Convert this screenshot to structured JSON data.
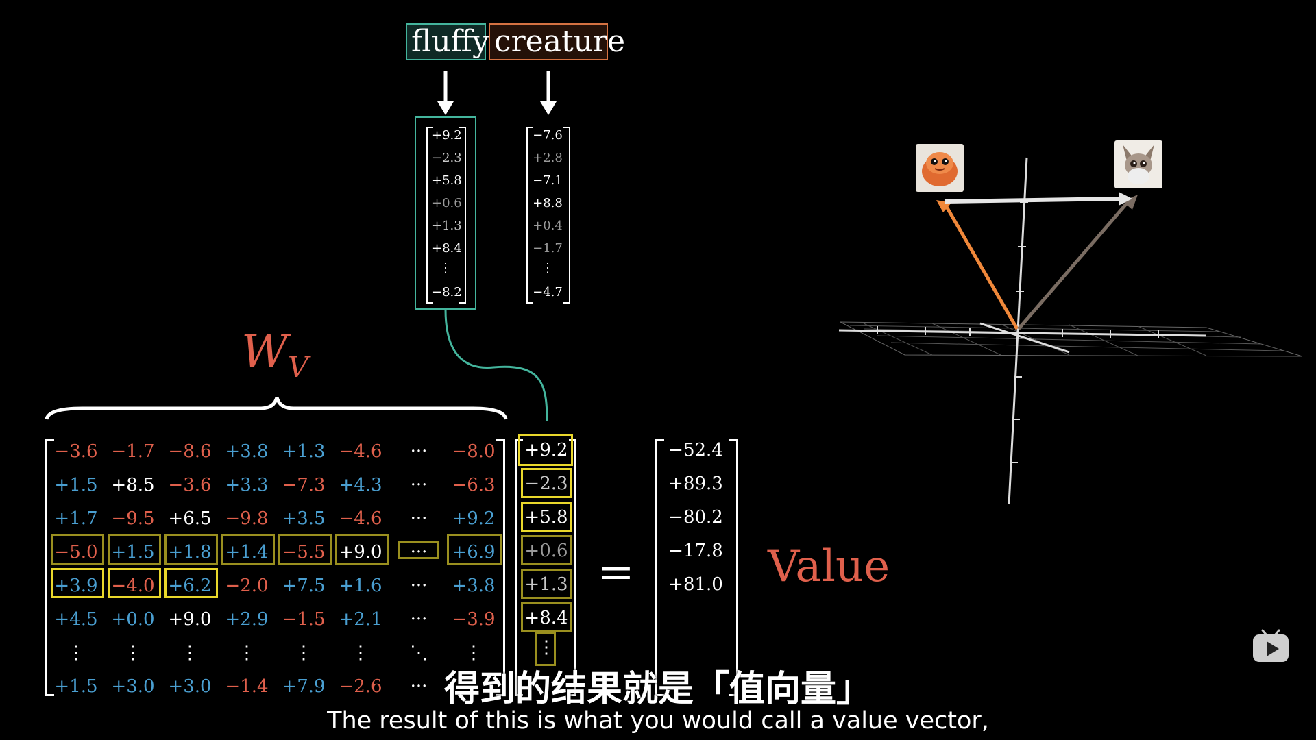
{
  "tokens": [
    {
      "text": "fluffy",
      "color": "#44b59d"
    },
    {
      "text": "creature",
      "color": "#d57242"
    }
  ],
  "embedding_fluffy": [
    "+9.2",
    "−2.3",
    "+5.8",
    "+0.6",
    "+1.3",
    "+8.4",
    "⋮",
    "−8.2"
  ],
  "embedding_creature": [
    "−7.6",
    "+2.8",
    "−7.1",
    "+8.8",
    "+0.4",
    "−1.7",
    "⋮",
    "−4.7"
  ],
  "matrix_label": {
    "main": "W",
    "sub": "V"
  },
  "matrix": [
    [
      [
        "−3.6",
        "red"
      ],
      [
        "−1.7",
        "red"
      ],
      [
        "−8.6",
        "red"
      ],
      [
        "+3.8",
        "blue"
      ],
      [
        "+1.3",
        "blue"
      ],
      [
        "−4.6",
        "red"
      ],
      [
        "···",
        "white"
      ],
      [
        "−8.0",
        "red"
      ]
    ],
    [
      [
        "+1.5",
        "blue"
      ],
      [
        "+8.5",
        "white"
      ],
      [
        "−3.6",
        "red"
      ],
      [
        "+3.3",
        "blue"
      ],
      [
        "−7.3",
        "red"
      ],
      [
        "+4.3",
        "blue"
      ],
      [
        "···",
        "white"
      ],
      [
        "−6.3",
        "red"
      ]
    ],
    [
      [
        "+1.7",
        "blue"
      ],
      [
        "−9.5",
        "red"
      ],
      [
        "+6.5",
        "white"
      ],
      [
        "−9.8",
        "red"
      ],
      [
        "+3.5",
        "blue"
      ],
      [
        "−4.6",
        "red"
      ],
      [
        "···",
        "white"
      ],
      [
        "+9.2",
        "blue"
      ]
    ],
    [
      [
        "−5.0",
        "red"
      ],
      [
        "+1.5",
        "blue"
      ],
      [
        "+1.8",
        "blue"
      ],
      [
        "+1.4",
        "blue"
      ],
      [
        "−5.5",
        "red"
      ],
      [
        "+9.0",
        "white"
      ],
      [
        "···",
        "white"
      ],
      [
        "+6.9",
        "blue"
      ]
    ],
    [
      [
        "+3.9",
        "blue"
      ],
      [
        "−4.0",
        "red"
      ],
      [
        "+6.2",
        "blue"
      ],
      [
        "−2.0",
        "red"
      ],
      [
        "+7.5",
        "blue"
      ],
      [
        "+1.6",
        "blue"
      ],
      [
        "···",
        "white"
      ],
      [
        "+3.8",
        "blue"
      ]
    ],
    [
      [
        "+4.5",
        "blue"
      ],
      [
        "+0.0",
        "blue"
      ],
      [
        "+9.0",
        "white"
      ],
      [
        "+2.9",
        "blue"
      ],
      [
        "−1.5",
        "red"
      ],
      [
        "+2.1",
        "blue"
      ],
      [
        "···",
        "white"
      ],
      [
        "−3.9",
        "red"
      ]
    ],
    [
      [
        "⋮",
        "white"
      ],
      [
        "⋮",
        "white"
      ],
      [
        "⋮",
        "white"
      ],
      [
        "⋮",
        "white"
      ],
      [
        "⋮",
        "white"
      ],
      [
        "⋮",
        "white"
      ],
      [
        "⋱",
        "white"
      ],
      [
        "⋮",
        "white"
      ]
    ],
    [
      [
        "+1.5",
        "blue"
      ],
      [
        "+3.0",
        "blue"
      ],
      [
        "+3.0",
        "blue"
      ],
      [
        "−1.4",
        "red"
      ],
      [
        "+7.9",
        "blue"
      ],
      [
        "−2.6",
        "red"
      ],
      [
        "···",
        "white"
      ],
      [
        "",
        ""
      ]
    ]
  ],
  "input_vector": [
    "+9.2",
    "−2.3",
    "+5.8",
    "+0.6",
    "+1.3",
    "+8.4",
    "⋮"
  ],
  "equals": "=",
  "result_vector": [
    "−52.4",
    "+89.3",
    "−80.2",
    "−17.8",
    "+81.0"
  ],
  "result_label": "Value",
  "subtitle_zh": "得到的结果就是「值向量」",
  "subtitle_en": "The result of this is what you would call a value vector,",
  "colors": {
    "red": "#e0604c",
    "blue": "#4a9fd1",
    "teal": "#44b59d",
    "orange": "#d57242",
    "yellow": "#e9d72b"
  },
  "icons": [
    "fluffy-creature-thumbnail",
    "creature-thumbnail",
    "bilibili-tv-icon"
  ]
}
